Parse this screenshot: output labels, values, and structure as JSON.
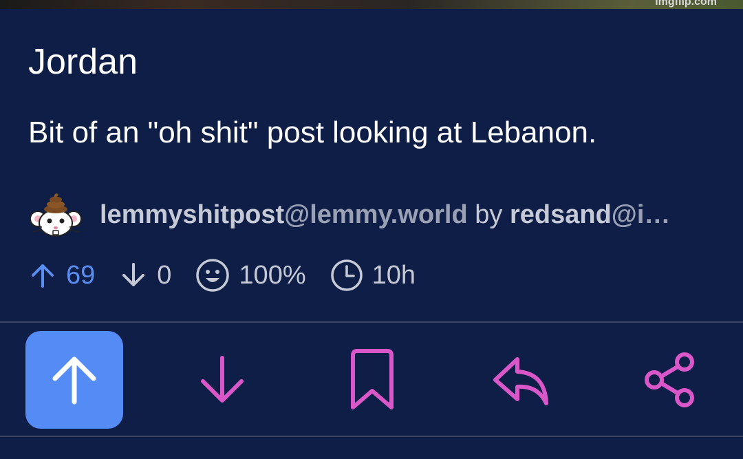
{
  "image": {
    "watermark": "imgflip.com"
  },
  "post": {
    "title": "Jordan",
    "body": "Bit of an \"oh shit\" post looking at Lebanon."
  },
  "meta": {
    "community_name": "lemmyshitpost",
    "community_instance": "@lemmy.world",
    "by": "by",
    "author_name": "redsand",
    "author_instance": "@i…"
  },
  "stats": {
    "upvotes": "69",
    "downvotes": "0",
    "ratio": "100%",
    "age": "10h"
  },
  "actions": {
    "upvote_active": true
  },
  "colors": {
    "background": "#0f1e47",
    "accent_blue": "#558bf5",
    "action_pink": "#d957c8",
    "muted_text": "#c6cad6"
  },
  "icons": {
    "avatar": "mouse-poop-avatar-icon",
    "up": "arrow-up-icon",
    "down": "arrow-down-icon",
    "ratio": "smiley-face-icon",
    "time": "clock-icon",
    "save": "bookmark-icon",
    "reply": "reply-icon",
    "share": "share-icon"
  }
}
